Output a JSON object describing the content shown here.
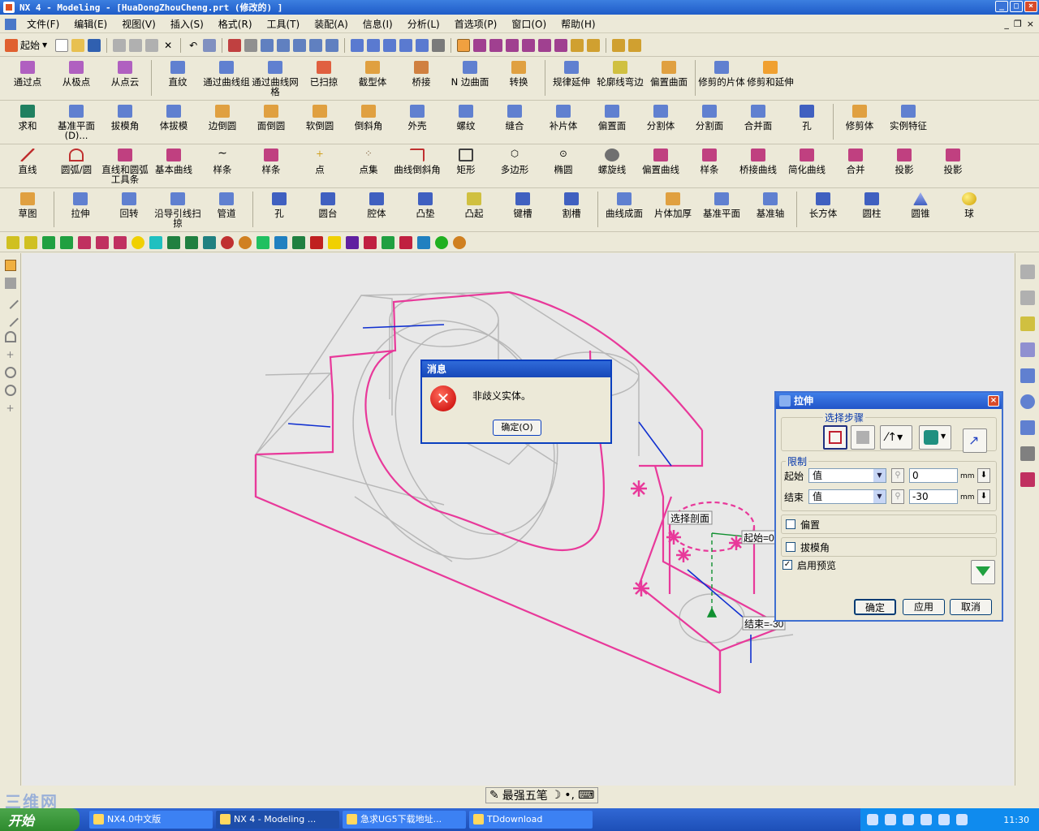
{
  "window": {
    "title": "NX 4 - Modeling - [HuaDongZhouCheng.prt (修改的) ]"
  },
  "menu": [
    "文件(F)",
    "编辑(E)",
    "视图(V)",
    "插入(S)",
    "格式(R)",
    "工具(T)",
    "装配(A)",
    "信息(I)",
    "分析(L)",
    "首选项(P)",
    "窗口(O)",
    "帮助(H)"
  ],
  "start_label": "起始",
  "toolbar_curves_surfaces": [
    "通过点",
    "从极点",
    "从点云",
    "直纹",
    "通过曲线组",
    "通过曲线网格",
    "已扫掠",
    "截型体",
    "桥接",
    "N 边曲面",
    "转换",
    "规律延伸",
    "轮廓线弯边",
    "偏置曲面",
    "修剪的片体",
    "修剪和延伸"
  ],
  "toolbar_features": [
    "求和",
    "基准平面(D)...",
    "拔模角",
    "体拔模",
    "边倒圆",
    "面倒圆",
    "软倒圆",
    "倒斜角",
    "外壳",
    "螺纹",
    "缝合",
    "补片体",
    "偏置面",
    "分割体",
    "分割面",
    "合并面",
    "孔",
    "修剪体",
    "实例特征"
  ],
  "toolbar_curves": [
    "直线",
    "圆弧/圆",
    "直线和圆弧工具条",
    "基本曲线",
    "样条",
    "样条",
    "点",
    "点集",
    "曲线倒斜角",
    "矩形",
    "多边形",
    "椭圆",
    "螺旋线",
    "偏置曲线",
    "样条",
    "桥接曲线",
    "简化曲线",
    "合并",
    "投影",
    "投影"
  ],
  "toolbar_form": [
    "草图",
    "拉伸",
    "回转",
    "沿导引线扫掠",
    "管道",
    "孔",
    "圆台",
    "腔体",
    "凸垫",
    "凸起",
    "键槽",
    "割槽",
    "曲线成面",
    "片体加厚",
    "基准平面",
    "基准轴",
    "长方体",
    "圆柱",
    "圆锥",
    "球"
  ],
  "viewport": {
    "labels": {
      "section": "选择剖面",
      "start": "起始=0",
      "end": "结束=-30"
    }
  },
  "message_dialog": {
    "title": "消息",
    "text": "非歧义实体。",
    "ok": "确定(O)"
  },
  "extrude_dialog": {
    "title": "拉伸",
    "steps_title": "选择步骤",
    "limits_title": "限制",
    "start_label": "起始",
    "start_mode": "值",
    "start_value": "0",
    "end_label": "结束",
    "end_mode": "值",
    "end_value": "-30",
    "unit": "mm",
    "offset_label": "偏置",
    "draft_label": "拔模角",
    "preview_label": "启用预览",
    "preview_checked": true,
    "ok": "确定",
    "apply": "应用",
    "cancel": "取消"
  },
  "ime": {
    "label": "最强五笔"
  },
  "watermark": "三维网",
  "taskbar": {
    "start": "开始",
    "tasks": [
      "NX4.0中文版",
      "NX 4 - Modeling ...",
      "急求UG5下载地址...",
      "TDdownload"
    ],
    "clock": "11:30"
  },
  "colors": {
    "accent": "#1f5cc8",
    "model_pink": "#e8399a",
    "model_gray": "#b8b8b8",
    "model_blue": "#1030d0"
  }
}
